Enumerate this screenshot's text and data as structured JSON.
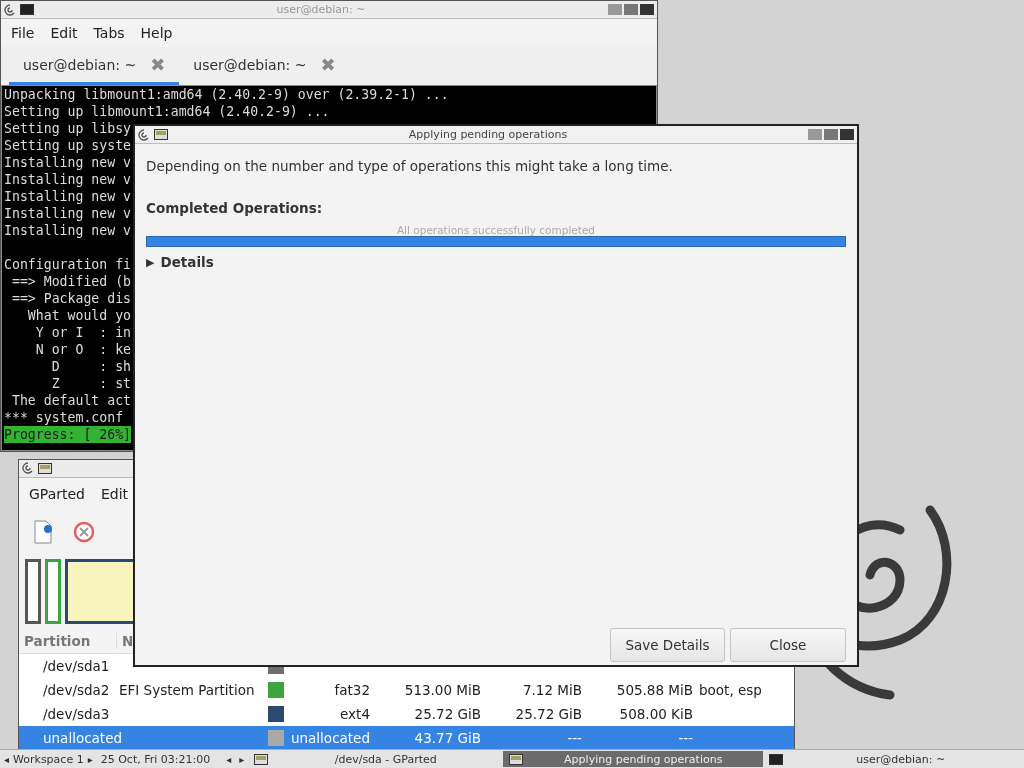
{
  "terminal": {
    "title": "user@debian: ~",
    "menu": [
      "File",
      "Edit",
      "Tabs",
      "Help"
    ],
    "tabs": [
      {
        "label": "user@debian: ~",
        "close": "✖",
        "selected": true
      },
      {
        "label": "user@debian: ~",
        "close": "✖",
        "selected": false
      }
    ],
    "lines": [
      {
        "kind": "output",
        "text": "Unpacking libmount1:amd64 (2.40.2-9) over (2.39.2-1) ..."
      },
      {
        "kind": "output",
        "text": "Setting up libmount1:amd64 (2.40.2-9) ..."
      },
      {
        "kind": "output",
        "text": "Setting up libsy"
      },
      {
        "kind": "output",
        "text": "Setting up syste"
      },
      {
        "kind": "output",
        "text": "Installing new v"
      },
      {
        "kind": "output",
        "text": "Installing new v"
      },
      {
        "kind": "output",
        "text": "Installing new v"
      },
      {
        "kind": "output",
        "text": "Installing new v"
      },
      {
        "kind": "output",
        "text": "Installing new v"
      },
      {
        "kind": "blank"
      },
      {
        "kind": "output",
        "text": "Configuration fi"
      },
      {
        "kind": "output",
        "text": " ==> Modified (b"
      },
      {
        "kind": "output",
        "text": " ==> Package dis"
      },
      {
        "kind": "output",
        "text": "   What would yo"
      },
      {
        "kind": "output",
        "text": "    Y or I  : in"
      },
      {
        "kind": "output",
        "text": "    N or O  : ke"
      },
      {
        "kind": "output",
        "text": "      D     : sh"
      },
      {
        "kind": "output",
        "text": "      Z     : st"
      },
      {
        "kind": "output",
        "text": " The default act"
      },
      {
        "kind": "output",
        "text": "*** system.conf"
      },
      {
        "kind": "status",
        "text": "Progress: [ 26%]"
      }
    ]
  },
  "gparted": {
    "menu": [
      "GParted",
      "Edit"
    ],
    "columns": [
      "Partition",
      "N"
    ],
    "rows": [
      {
        "partition": "/dev/sda1",
        "color": "#6e6e6e",
        "selected": false
      },
      {
        "partition": "/dev/sda2",
        "name": "EFI System Partition",
        "color": "#3ea43e",
        "filesystem": "fat32",
        "size": "513.00 MiB",
        "used": "7.12 MiB",
        "unused": "505.88 MiB",
        "flags": "boot, esp",
        "selected": false
      },
      {
        "partition": "/dev/sda3",
        "color": "#2c4a6e",
        "filesystem": "ext4",
        "size": "25.72 GiB",
        "used": "25.72 GiB",
        "unused": "508.00 KiB",
        "selected": false
      },
      {
        "partition": "unallocated",
        "color": "#a9a9a9",
        "filesystem": "unallocated",
        "size": "43.77 GiB",
        "used": "---",
        "unused": "---",
        "selected": true
      }
    ]
  },
  "dialog": {
    "title": "Applying pending operations",
    "message": "Depending on the number and type of operations this might take a long time.",
    "section": "Completed Operations:",
    "progress": {
      "caption": "All operations successfully completed",
      "level": 1
    },
    "details": {
      "arrow": "▶",
      "label": "Details",
      "expanded": false
    },
    "buttons": [
      "Save Details",
      "Close"
    ]
  },
  "taskbar": {
    "workspace": {
      "prev": "◂",
      "label": "Workspace 1",
      "next": "▸"
    },
    "clock": "25 Oct, Fri 03:21:00",
    "nav": [
      "◂",
      "▸"
    ],
    "tasks": [
      {
        "label": "/dev/sda - GParted",
        "kind": "gparted",
        "selected": false
      },
      {
        "label": "Applying pending operations",
        "kind": "gparted",
        "selected": true
      },
      {
        "label": "user@debian: ~",
        "kind": "terminal",
        "selected": false
      }
    ]
  }
}
